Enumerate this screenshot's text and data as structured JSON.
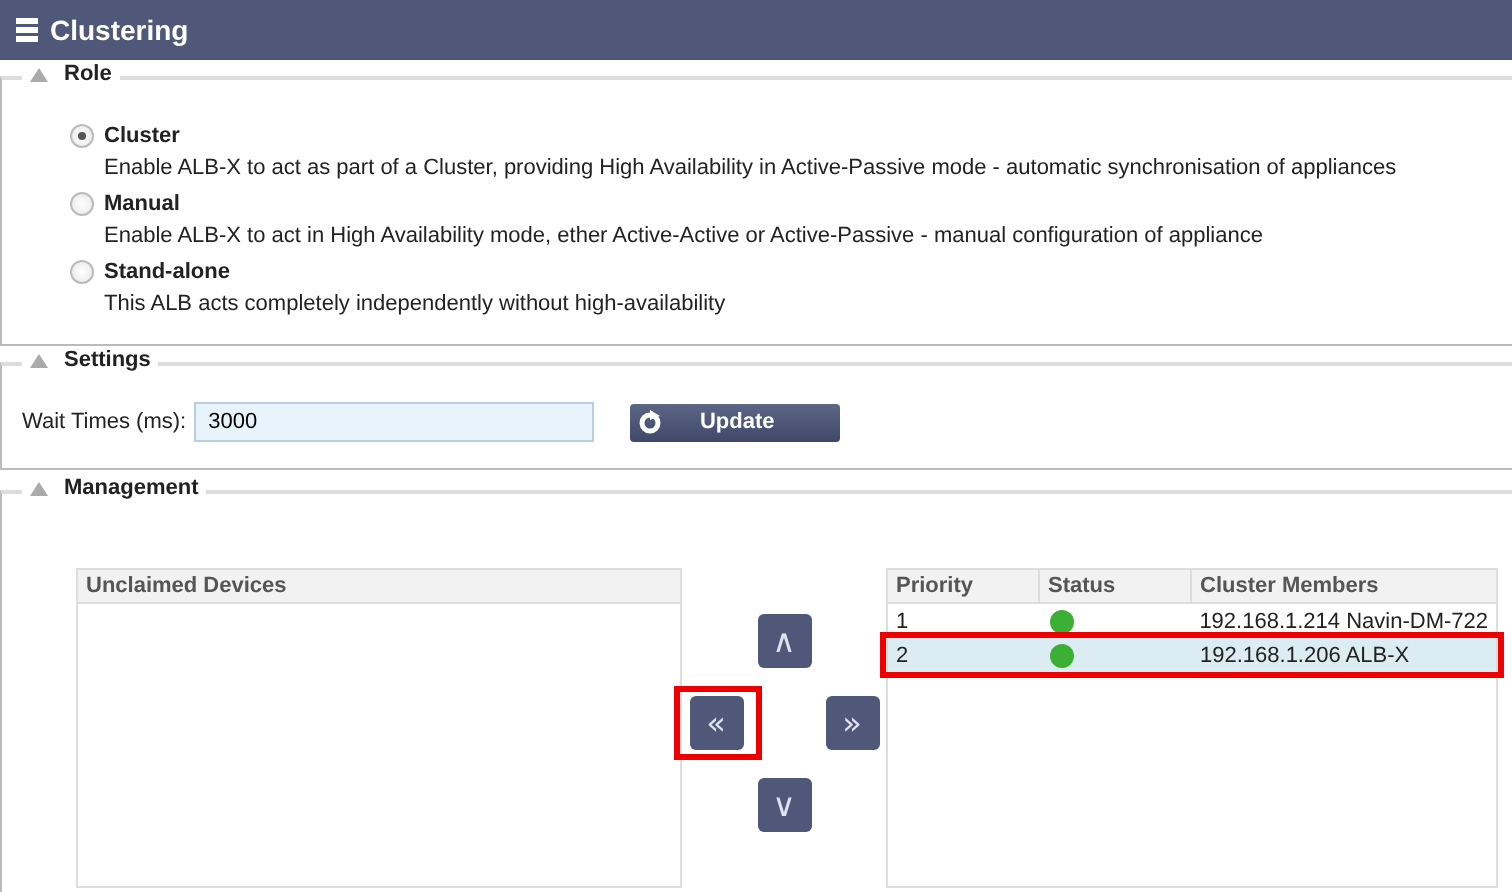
{
  "header": {
    "title": "Clustering"
  },
  "role": {
    "legend": "Role",
    "options": [
      {
        "label": "Cluster",
        "description": "Enable ALB-X to act as part of a Cluster, providing High Availability in Active-Passive mode - automatic synchronisation of appliances",
        "selected": true
      },
      {
        "label": "Manual",
        "description": "Enable ALB-X to act in High Availability mode, ether Active-Active or Active-Passive - manual configuration of appliance",
        "selected": false
      },
      {
        "label": "Stand-alone",
        "description": "This ALB acts completely independently without high-availability",
        "selected": false
      }
    ]
  },
  "settings": {
    "legend": "Settings",
    "wait_label": "Wait Times (ms):",
    "wait_value": "3000",
    "update_button": "Update"
  },
  "management": {
    "legend": "Management",
    "unclaimed": {
      "title": "Unclaimed Devices"
    },
    "move_buttons": [
      {
        "kind": "up",
        "label": "∧",
        "highlighted": false
      },
      {
        "kind": "left",
        "label": "«",
        "highlighted": true
      },
      {
        "kind": "right",
        "label": "»",
        "highlighted": false
      },
      {
        "kind": "down",
        "label": "∨",
        "highlighted": false
      }
    ],
    "members": {
      "columns": [
        "Priority",
        "Status",
        "Cluster Members"
      ],
      "rows": [
        {
          "priority": "1",
          "color": "#3cb034",
          "member": "192.168.1.214 Navin-DM-722",
          "selected": false,
          "highlighted": false
        },
        {
          "priority": "2",
          "color": "#3cb034",
          "member": "192.168.1.206 ALB-X",
          "selected": true,
          "highlighted": true
        }
      ]
    }
  }
}
